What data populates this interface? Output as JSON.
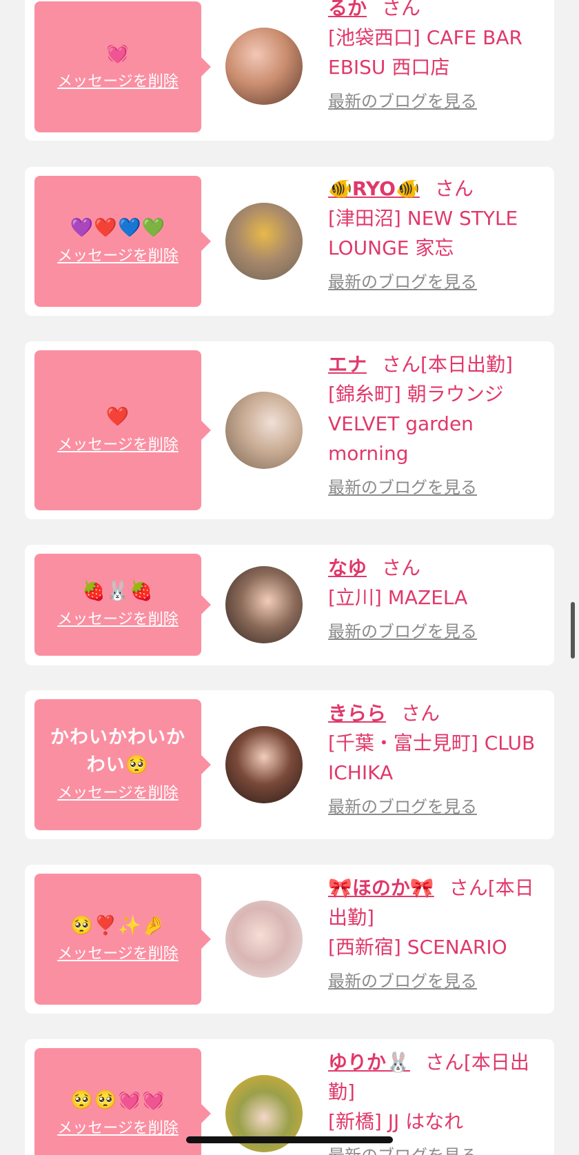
{
  "delete_label": "メッセージを削除",
  "blog_label": "最新のブログを見る",
  "san_suffix": "さん",
  "colors": {
    "accent": "#e0386a",
    "bubble": "#fb8fa2",
    "link_gray": "#8a8a8a",
    "background": "#f2f2f2"
  },
  "items": [
    {
      "message": "💓",
      "name": "るか",
      "status": "",
      "store": "[池袋西口] CAFE BAR EBISU 西口店"
    },
    {
      "message": "💜❤️💙💚",
      "name": "🐠RYO🐠",
      "status": "",
      "store": "[津田沼] NEW STYLE LOUNGE 家忘"
    },
    {
      "message": "❤️",
      "name": "エナ",
      "status": "[本日出勤]",
      "store": "[錦糸町] 朝ラウンジ VELVET garden morning"
    },
    {
      "message": "🍓🐰🍓",
      "name": "なゆ",
      "status": "",
      "store": "[立川] MAZELA"
    },
    {
      "message": "かわいかわいかわい🥺",
      "name": "きらら",
      "status": "",
      "store": "[千葉・富士見町] CLUB ICHIKA"
    },
    {
      "message": "🥺❣️✨🤌",
      "name": "🎀ほのか🎀",
      "status": "[本日出勤]",
      "store": "[西新宿] SCENARIO"
    },
    {
      "message": "🥺🥺💓💓",
      "name": "ゆりか🐰",
      "status": "[本日出勤]",
      "store": "[新橋] JJ はなれ"
    }
  ]
}
